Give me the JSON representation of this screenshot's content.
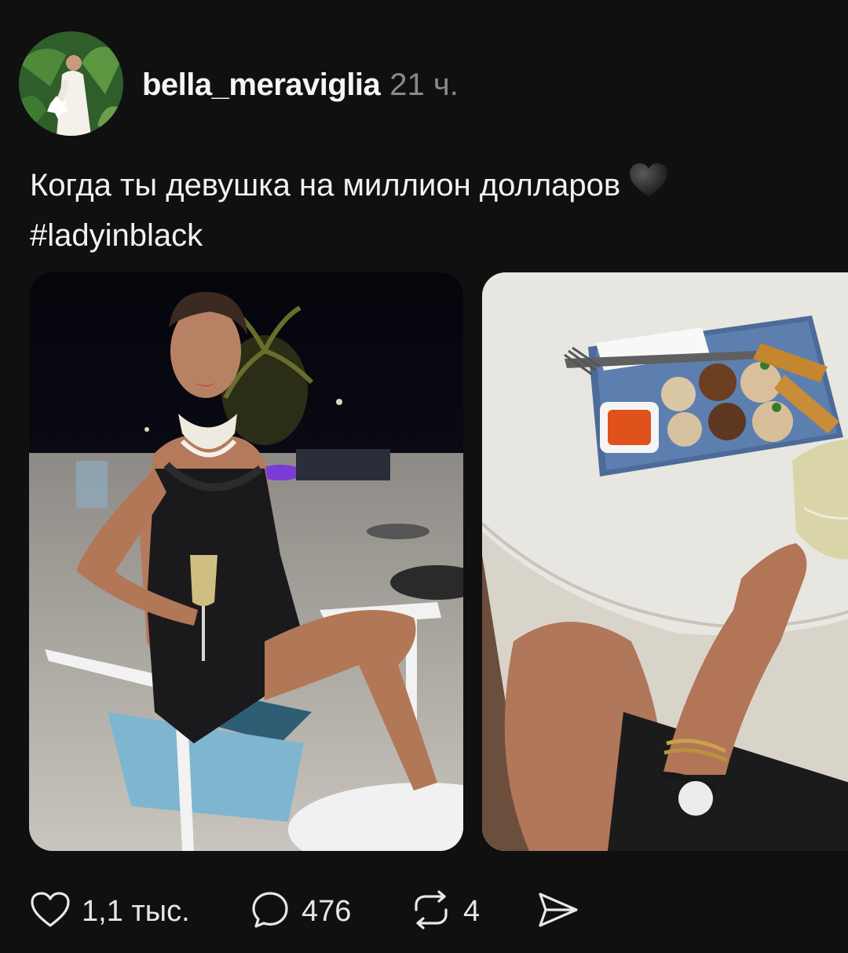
{
  "post": {
    "author": {
      "username": "bella_meraviglia",
      "avatar_alt": "avatar"
    },
    "timestamp": "21 ч.",
    "caption": {
      "text": "Когда ты девушка на миллион долларов",
      "emoji": "black-heart",
      "hashtag": "#ladyinblack"
    },
    "media": [
      {
        "alt": "woman in black dress with champagne on a beach at night"
      },
      {
        "alt": "table with tray of appetizers and glass of champagne"
      }
    ]
  },
  "actions": {
    "likes": {
      "icon": "heart-icon",
      "count": "1,1 тыс."
    },
    "comments": {
      "icon": "comment-icon",
      "count": "476"
    },
    "reposts": {
      "icon": "repost-icon",
      "count": "4"
    },
    "share": {
      "icon": "send-icon"
    }
  },
  "colors": {
    "background": "#101010",
    "text": "#f3f3f3",
    "muted": "#8a8a8a"
  }
}
